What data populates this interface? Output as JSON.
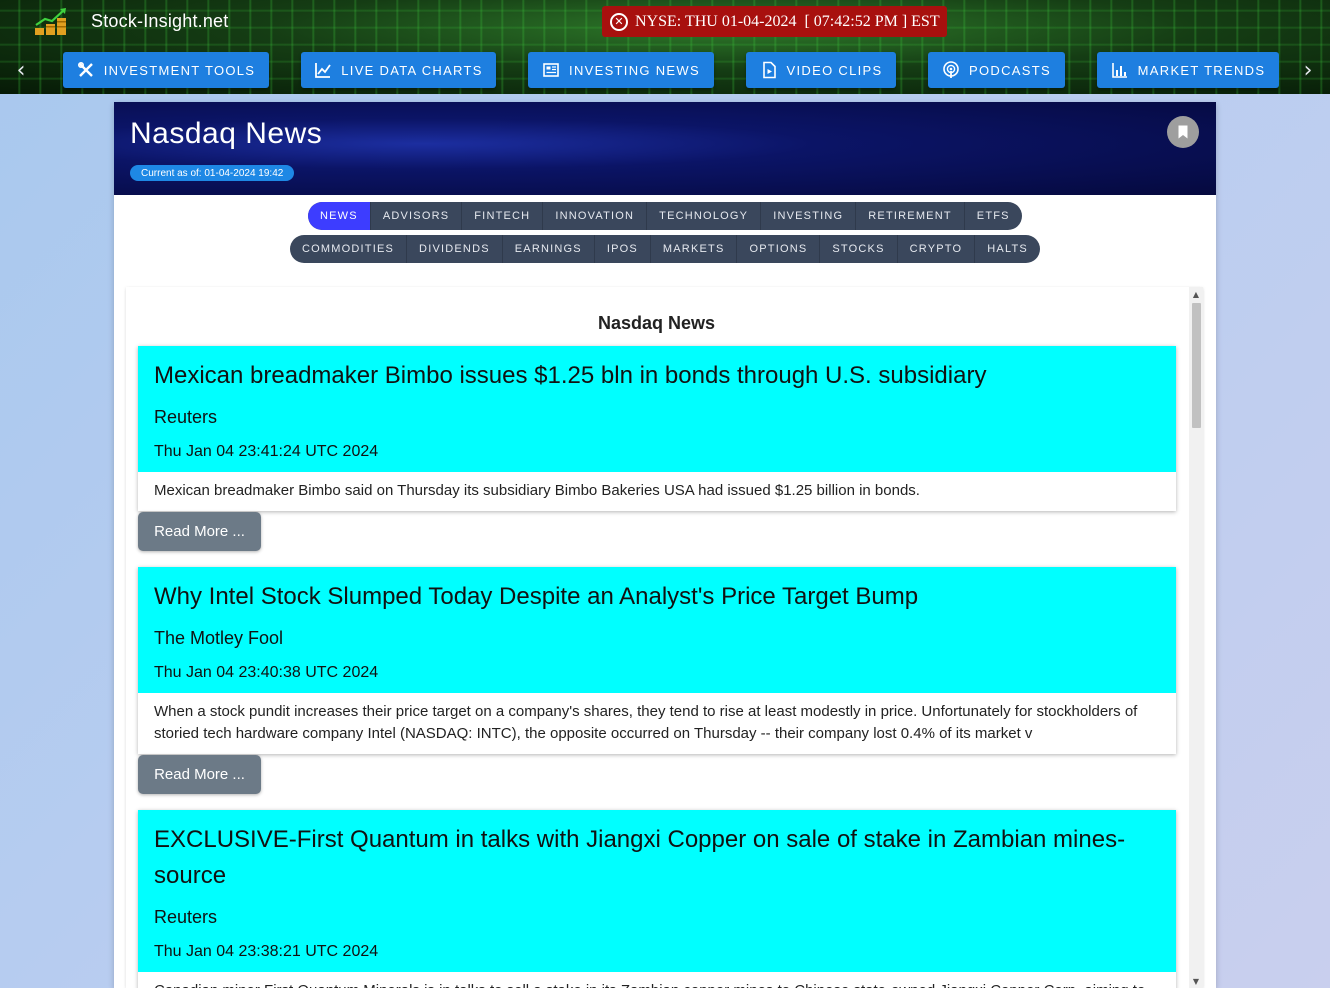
{
  "header": {
    "site_name": "Stock-Insight.net",
    "market_status": "NYSE: THU 01-04-2024  [ 07:42:52 PM ] EST",
    "nav_prev_icon": "chevron-left-icon",
    "nav_next_icon": "chevron-right-icon",
    "nav": [
      {
        "label": "INVESTMENT TOOLS",
        "icon": "tools-icon"
      },
      {
        "label": "LIVE DATA CHARTS",
        "icon": "line-chart-icon"
      },
      {
        "label": "INVESTING NEWS",
        "icon": "newspaper-icon"
      },
      {
        "label": "VIDEO CLIPS",
        "icon": "video-file-icon"
      },
      {
        "label": "PODCASTS",
        "icon": "podcast-icon"
      },
      {
        "label": "MARKET TRENDS",
        "icon": "bar-chart-icon"
      }
    ]
  },
  "panel": {
    "title": "Nasdaq News",
    "as_of": "Current as of: 01-04-2024 19:42",
    "bookmark_icon": "bookmark-icon",
    "tabs_row1": [
      "NEWS",
      "ADVISORS",
      "FINTECH",
      "INNOVATION",
      "TECHNOLOGY",
      "INVESTING",
      "RETIREMENT",
      "ETFS"
    ],
    "tabs_row2": [
      "COMMODITIES",
      "DIVIDENDS",
      "EARNINGS",
      "IPOS",
      "MARKETS",
      "OPTIONS",
      "STOCKS",
      "CRYPTO",
      "HALTS"
    ],
    "active_tab": "NEWS"
  },
  "feed": {
    "title": "Nasdaq News",
    "read_more_label": "Read More ...",
    "articles": [
      {
        "headline": "Mexican breadmaker Bimbo issues $1.25 bln in bonds through U.S. subsidiary",
        "source": "Reuters",
        "date": "Thu Jan 04 23:41:24 UTC 2024",
        "summary": "Mexican breadmaker Bimbo said on Thursday its subsidiary Bimbo Bakeries USA had issued $1.25 billion in bonds."
      },
      {
        "headline": "Why Intel Stock Slumped Today Despite an Analyst's Price Target Bump",
        "source": "The Motley Fool",
        "date": "Thu Jan 04 23:40:38 UTC 2024",
        "summary": "When a stock pundit increases their price target on a company's shares, they tend to rise at least modestly in price. Unfortunately for stockholders of storied tech hardware company Intel (NASDAQ: INTC), the opposite occurred on Thursday -- their company lost 0.4% of its market v"
      },
      {
        "headline": "EXCLUSIVE-First Quantum in talks with Jiangxi Copper on sale of stake in Zambian mines-source",
        "source": "Reuters",
        "date": "Thu Jan 04 23:38:21 UTC 2024",
        "summary": "Canadian miner First Quantum Minerals is in talks to sell a stake in its Zambian copper mines to Chinese state-owned Jiangxi Copper Corp, aiming to"
      }
    ]
  },
  "colors": {
    "nav_button": "#1e7fe0",
    "market_badge": "#a8100e",
    "card_highlight": "#00ffff",
    "active_tab": "#3d3dff"
  }
}
